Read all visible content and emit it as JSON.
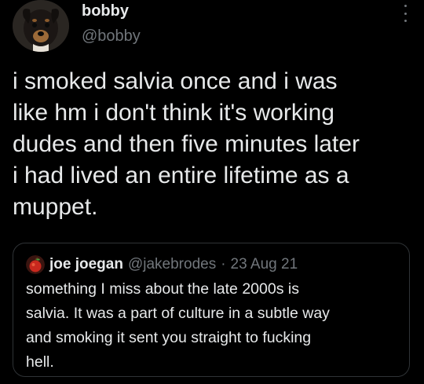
{
  "tweet": {
    "author_name": "bobby",
    "author_handle": "@bobby",
    "avatar_icon": "dog-avatar",
    "more_icon": "vertical-dots-icon",
    "text": "i smoked salvia once and i was\nlike hm i don't think it's working\ndudes and then five minutes later\ni had lived an entire lifetime as a\nmuppet."
  },
  "quote": {
    "author_name": "joe joegan",
    "author_handle": "@jakebrodes",
    "separator": "·",
    "date": "23 Aug 21",
    "avatar_icon": "red-apple-avatar",
    "text": "something I miss about the late 2000s is\nsalvia. It was a part of culture in a subtle way\nand smoking it sent you straight to fucking\nhell."
  },
  "colors": {
    "background": "#000000",
    "primary_text": "#e7e9ea",
    "secondary_text": "#71767b",
    "border": "#2f3336"
  }
}
